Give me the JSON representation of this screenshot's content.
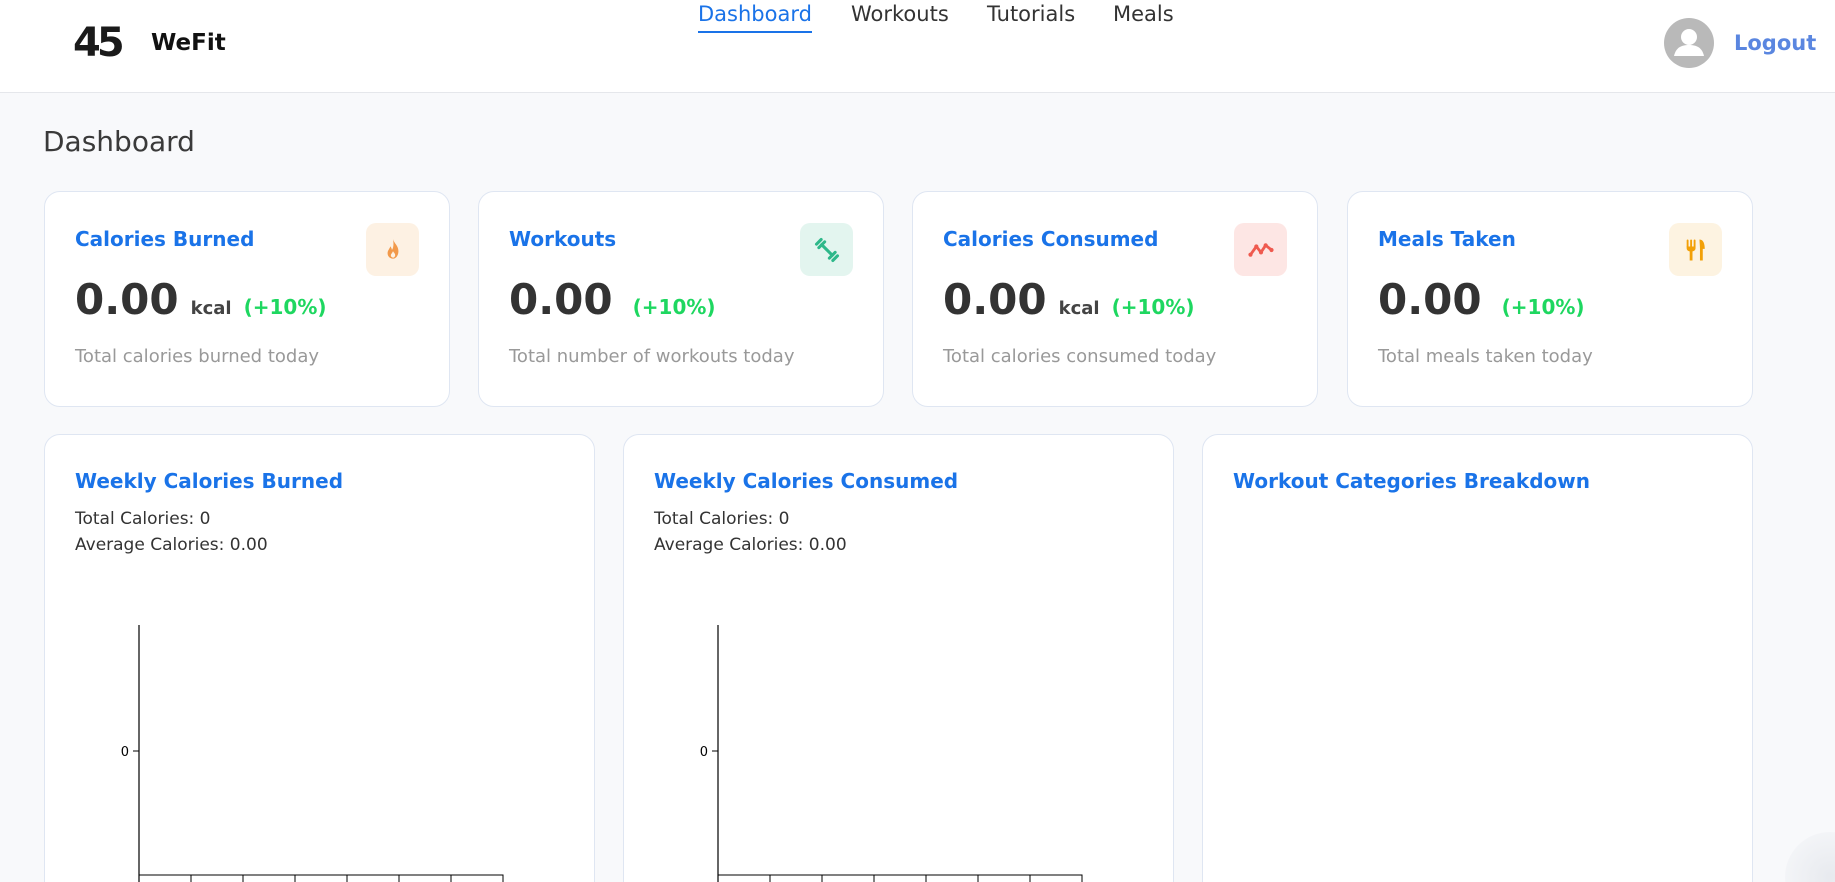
{
  "header": {
    "logo_text": "45",
    "brand": "WeFit",
    "nav": [
      {
        "label": "Dashboard",
        "active": true
      },
      {
        "label": "Workouts",
        "active": false
      },
      {
        "label": "Tutorials",
        "active": false
      },
      {
        "label": "Meals",
        "active": false
      }
    ],
    "logout_label": "Logout",
    "avatar_icon": "user-avatar-icon"
  },
  "page": {
    "title": "Dashboard"
  },
  "stats": [
    {
      "title": "Calories Burned",
      "value": "0.00",
      "unit": "kcal",
      "change": "(+10%)",
      "description": "Total calories burned today",
      "icon": "fire-icon",
      "icon_color": "#f2994a",
      "icon_bg": "#fdf1e3"
    },
    {
      "title": "Workouts",
      "value": "0.00",
      "unit": "",
      "change": "(+10%)",
      "description": "Total number of workouts today",
      "icon": "dumbbell-icon",
      "icon_color": "#2eb88a",
      "icon_bg": "#e3f5ef"
    },
    {
      "title": "Calories Consumed",
      "value": "0.00",
      "unit": "kcal",
      "change": "(+10%)",
      "description": "Total calories consumed today",
      "icon": "trend-line-icon",
      "icon_color": "#ef5a4f",
      "icon_bg": "#fde6e4"
    },
    {
      "title": "Meals Taken",
      "value": "0.00",
      "unit": "",
      "change": "(+10%)",
      "description": "Total meals taken today",
      "icon": "fork-knife-icon",
      "icon_color": "#f2a007",
      "icon_bg": "#fdf3e1"
    }
  ],
  "charts": [
    {
      "title": "Weekly Calories Burned",
      "total_label": "Total Calories: 0",
      "average_label": "Average Calories: 0.00"
    },
    {
      "title": "Weekly Calories Consumed",
      "total_label": "Total Calories: 0",
      "average_label": "Average Calories: 0.00"
    },
    {
      "title": "Workout Categories Breakdown"
    }
  ],
  "chart_data": [
    {
      "type": "bar",
      "title": "Weekly Calories Burned",
      "categories": [
        "",
        "",
        "",
        "",
        "",
        "",
        ""
      ],
      "values": [
        0,
        0,
        0,
        0,
        0,
        0,
        0
      ],
      "y_ticks": [
        "0"
      ],
      "grid": false
    },
    {
      "type": "bar",
      "title": "Weekly Calories Consumed",
      "categories": [
        "",
        "",
        "",
        "",
        "",
        "",
        ""
      ],
      "values": [
        0,
        0,
        0,
        0,
        0,
        0,
        0
      ],
      "y_ticks": [
        "0"
      ],
      "grid": false
    },
    {
      "type": "pie",
      "title": "Workout Categories Breakdown",
      "categories": [],
      "values": []
    }
  ],
  "colors": {
    "accent": "#1a73e8",
    "positive": "#1ed760",
    "logout": "#5a86e0"
  }
}
